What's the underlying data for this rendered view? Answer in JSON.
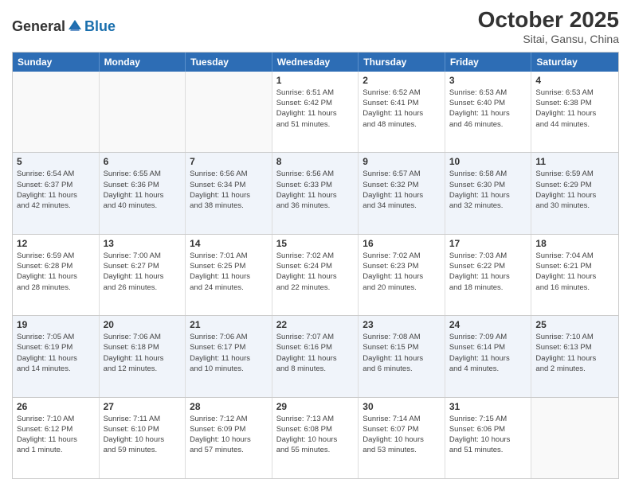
{
  "header": {
    "logo": {
      "general": "General",
      "blue": "Blue"
    },
    "title": "October 2025",
    "subtitle": "Sitai, Gansu, China"
  },
  "weekdays": [
    "Sunday",
    "Monday",
    "Tuesday",
    "Wednesday",
    "Thursday",
    "Friday",
    "Saturday"
  ],
  "rows": [
    {
      "alt": false,
      "cells": [
        {
          "day": "",
          "info": ""
        },
        {
          "day": "",
          "info": ""
        },
        {
          "day": "",
          "info": ""
        },
        {
          "day": "1",
          "info": "Sunrise: 6:51 AM\nSunset: 6:42 PM\nDaylight: 11 hours\nand 51 minutes."
        },
        {
          "day": "2",
          "info": "Sunrise: 6:52 AM\nSunset: 6:41 PM\nDaylight: 11 hours\nand 48 minutes."
        },
        {
          "day": "3",
          "info": "Sunrise: 6:53 AM\nSunset: 6:40 PM\nDaylight: 11 hours\nand 46 minutes."
        },
        {
          "day": "4",
          "info": "Sunrise: 6:53 AM\nSunset: 6:38 PM\nDaylight: 11 hours\nand 44 minutes."
        }
      ]
    },
    {
      "alt": true,
      "cells": [
        {
          "day": "5",
          "info": "Sunrise: 6:54 AM\nSunset: 6:37 PM\nDaylight: 11 hours\nand 42 minutes."
        },
        {
          "day": "6",
          "info": "Sunrise: 6:55 AM\nSunset: 6:36 PM\nDaylight: 11 hours\nand 40 minutes."
        },
        {
          "day": "7",
          "info": "Sunrise: 6:56 AM\nSunset: 6:34 PM\nDaylight: 11 hours\nand 38 minutes."
        },
        {
          "day": "8",
          "info": "Sunrise: 6:56 AM\nSunset: 6:33 PM\nDaylight: 11 hours\nand 36 minutes."
        },
        {
          "day": "9",
          "info": "Sunrise: 6:57 AM\nSunset: 6:32 PM\nDaylight: 11 hours\nand 34 minutes."
        },
        {
          "day": "10",
          "info": "Sunrise: 6:58 AM\nSunset: 6:30 PM\nDaylight: 11 hours\nand 32 minutes."
        },
        {
          "day": "11",
          "info": "Sunrise: 6:59 AM\nSunset: 6:29 PM\nDaylight: 11 hours\nand 30 minutes."
        }
      ]
    },
    {
      "alt": false,
      "cells": [
        {
          "day": "12",
          "info": "Sunrise: 6:59 AM\nSunset: 6:28 PM\nDaylight: 11 hours\nand 28 minutes."
        },
        {
          "day": "13",
          "info": "Sunrise: 7:00 AM\nSunset: 6:27 PM\nDaylight: 11 hours\nand 26 minutes."
        },
        {
          "day": "14",
          "info": "Sunrise: 7:01 AM\nSunset: 6:25 PM\nDaylight: 11 hours\nand 24 minutes."
        },
        {
          "day": "15",
          "info": "Sunrise: 7:02 AM\nSunset: 6:24 PM\nDaylight: 11 hours\nand 22 minutes."
        },
        {
          "day": "16",
          "info": "Sunrise: 7:02 AM\nSunset: 6:23 PM\nDaylight: 11 hours\nand 20 minutes."
        },
        {
          "day": "17",
          "info": "Sunrise: 7:03 AM\nSunset: 6:22 PM\nDaylight: 11 hours\nand 18 minutes."
        },
        {
          "day": "18",
          "info": "Sunrise: 7:04 AM\nSunset: 6:21 PM\nDaylight: 11 hours\nand 16 minutes."
        }
      ]
    },
    {
      "alt": true,
      "cells": [
        {
          "day": "19",
          "info": "Sunrise: 7:05 AM\nSunset: 6:19 PM\nDaylight: 11 hours\nand 14 minutes."
        },
        {
          "day": "20",
          "info": "Sunrise: 7:06 AM\nSunset: 6:18 PM\nDaylight: 11 hours\nand 12 minutes."
        },
        {
          "day": "21",
          "info": "Sunrise: 7:06 AM\nSunset: 6:17 PM\nDaylight: 11 hours\nand 10 minutes."
        },
        {
          "day": "22",
          "info": "Sunrise: 7:07 AM\nSunset: 6:16 PM\nDaylight: 11 hours\nand 8 minutes."
        },
        {
          "day": "23",
          "info": "Sunrise: 7:08 AM\nSunset: 6:15 PM\nDaylight: 11 hours\nand 6 minutes."
        },
        {
          "day": "24",
          "info": "Sunrise: 7:09 AM\nSunset: 6:14 PM\nDaylight: 11 hours\nand 4 minutes."
        },
        {
          "day": "25",
          "info": "Sunrise: 7:10 AM\nSunset: 6:13 PM\nDaylight: 11 hours\nand 2 minutes."
        }
      ]
    },
    {
      "alt": false,
      "cells": [
        {
          "day": "26",
          "info": "Sunrise: 7:10 AM\nSunset: 6:12 PM\nDaylight: 11 hours\nand 1 minute."
        },
        {
          "day": "27",
          "info": "Sunrise: 7:11 AM\nSunset: 6:10 PM\nDaylight: 10 hours\nand 59 minutes."
        },
        {
          "day": "28",
          "info": "Sunrise: 7:12 AM\nSunset: 6:09 PM\nDaylight: 10 hours\nand 57 minutes."
        },
        {
          "day": "29",
          "info": "Sunrise: 7:13 AM\nSunset: 6:08 PM\nDaylight: 10 hours\nand 55 minutes."
        },
        {
          "day": "30",
          "info": "Sunrise: 7:14 AM\nSunset: 6:07 PM\nDaylight: 10 hours\nand 53 minutes."
        },
        {
          "day": "31",
          "info": "Sunrise: 7:15 AM\nSunset: 6:06 PM\nDaylight: 10 hours\nand 51 minutes."
        },
        {
          "day": "",
          "info": ""
        }
      ]
    }
  ]
}
